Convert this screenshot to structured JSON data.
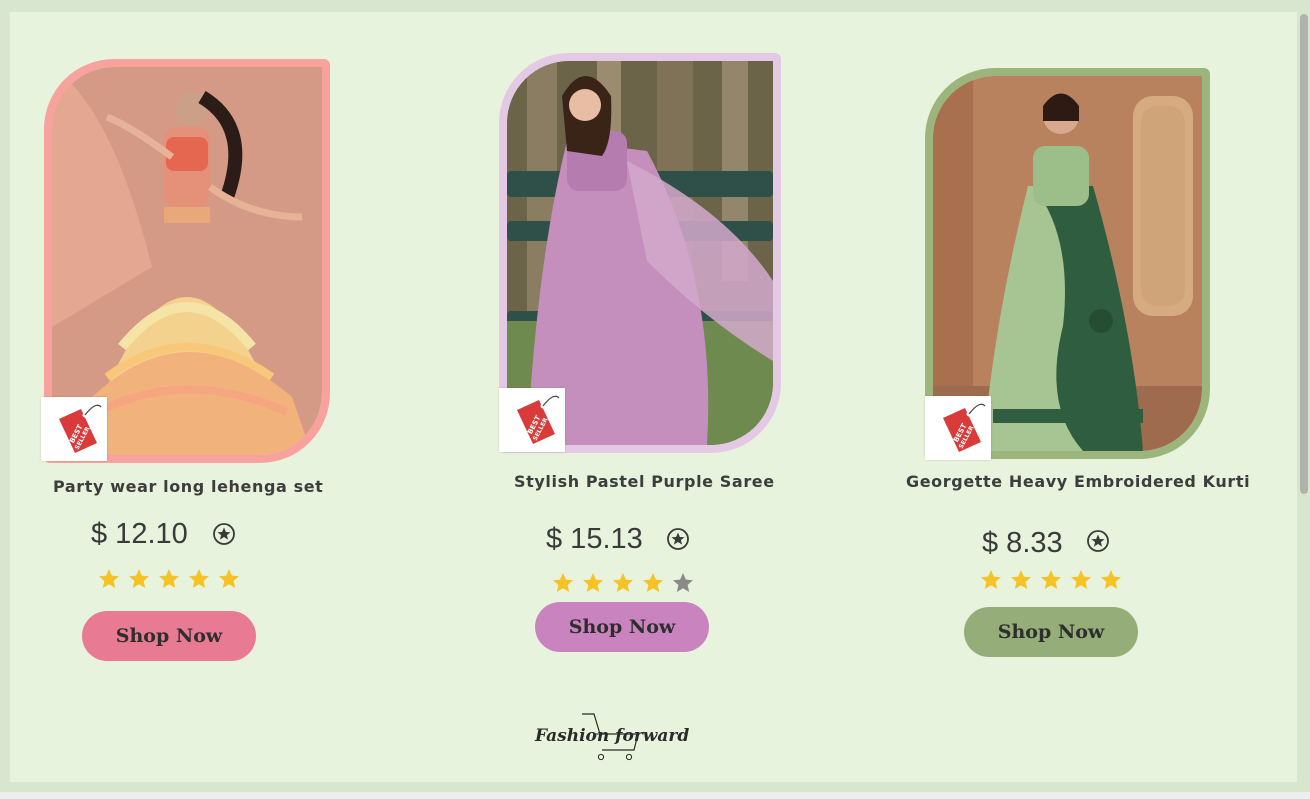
{
  "products": [
    {
      "title": "Party wear long lehenga set",
      "price": "$ 12.10",
      "rating": 5,
      "button_label": "Shop Now",
      "badge": "BEST SELLER",
      "frame_color": "#f7a29c",
      "button_color": "#e97a94",
      "star_filled_color": "#f6c327",
      "star_empty_color": "#8a8a8a"
    },
    {
      "title": "Stylish Pastel Purple Saree",
      "price": "$ 15.13",
      "rating": 4,
      "button_label": "Shop Now",
      "badge": "BEST SELLER",
      "frame_color": "#e4c9e4",
      "button_color": "#c984c0",
      "star_filled_color": "#f6c327",
      "star_empty_color": "#8a8a8a"
    },
    {
      "title": "Georgette Heavy Embroidered Kurti",
      "price": "$ 8.33",
      "rating": 5,
      "button_label": "Shop Now",
      "badge": "BEST SELLER",
      "frame_color": "#9cb57c",
      "button_color": "#95ad78",
      "star_filled_color": "#f6c327",
      "star_empty_color": "#8a8a8a"
    }
  ],
  "footer": {
    "logo_text": "Fashion forward"
  },
  "icons": {
    "price_award": "award-star-icon",
    "best_seller": "best-seller-tag-icon",
    "cart": "shopping-cart-icon"
  }
}
